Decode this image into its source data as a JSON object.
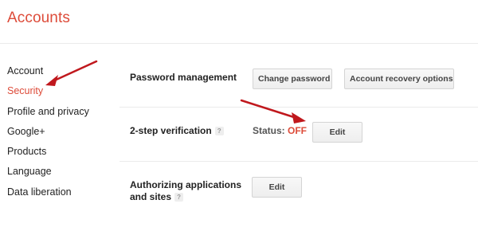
{
  "header": {
    "title": "Accounts"
  },
  "sidebar": {
    "items": [
      {
        "label": "Account",
        "active": false
      },
      {
        "label": "Security",
        "active": true
      },
      {
        "label": "Profile and privacy",
        "active": false
      },
      {
        "label": "Google+",
        "active": false
      },
      {
        "label": "Products",
        "active": false
      },
      {
        "label": "Language",
        "active": false
      },
      {
        "label": "Data liberation",
        "active": false
      }
    ]
  },
  "main": {
    "password": {
      "label": "Password management",
      "change_button": "Change password",
      "recovery_button": "Account recovery options"
    },
    "two_step": {
      "label": "2-step verification",
      "help": "?",
      "status_label": "Status:",
      "status_value": "OFF",
      "edit_button": "Edit"
    },
    "authorizing": {
      "label_line1": "Authorizing applications",
      "label_line2": "and sites",
      "help": "?",
      "edit_button": "Edit"
    }
  },
  "colors": {
    "accent": "#dd4b39",
    "arrow": "#c0181d"
  }
}
